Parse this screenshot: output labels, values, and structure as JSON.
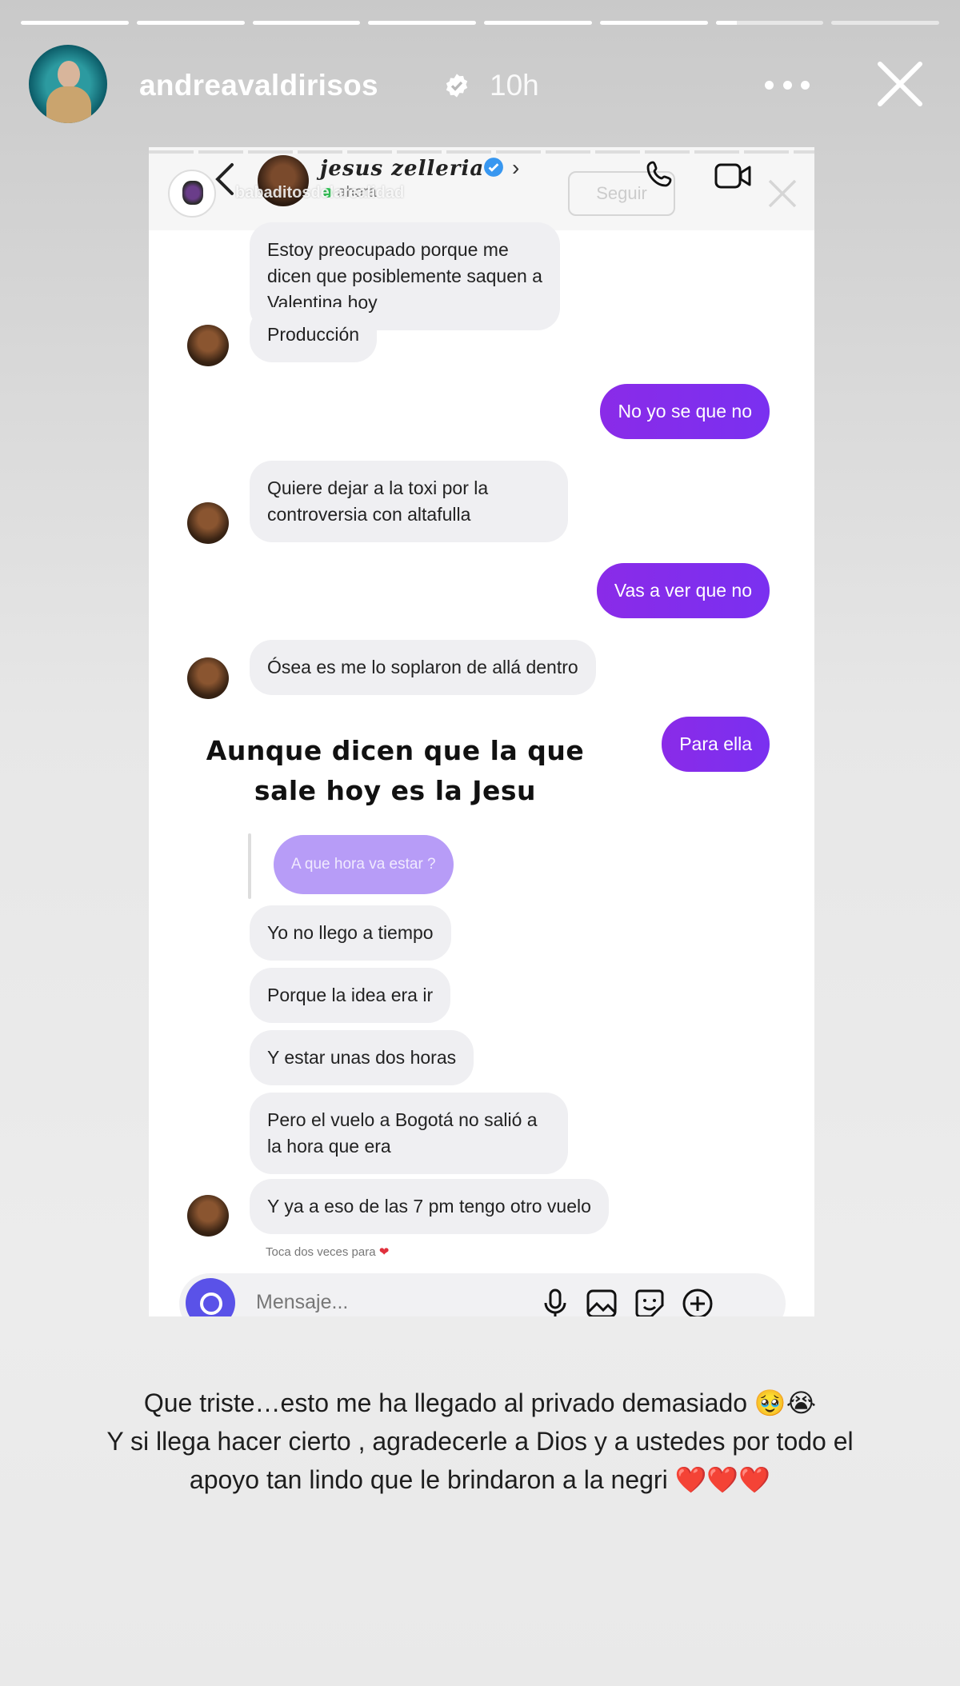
{
  "story": {
    "segments": [
      1,
      1,
      1,
      1,
      1,
      1,
      0.2,
      0
    ],
    "username": "andreavaldirisos",
    "time": "10h",
    "more_icon": "more-horizontal-icon",
    "close_icon": "close-icon"
  },
  "shared_chat": {
    "contact_name": "jesus zelleria",
    "status": "ahora",
    "overlay_handle": "babaditosdelarealidad",
    "overlay_follow": "Seguir",
    "messages": [
      {
        "dir": "in",
        "text": "Estoy preocupado porque me dicen que posiblemente saquen a Valentina hoy"
      },
      {
        "dir": "in",
        "text": "Producción"
      },
      {
        "dir": "out",
        "text": "No yo se que no"
      },
      {
        "dir": "in",
        "text": "Quiere dejar a la toxi por la controversia con altafulla"
      },
      {
        "dir": "out",
        "text": "Vas a ver que no"
      },
      {
        "dir": "in",
        "text": "Ósea es me lo soplaron de allá dentro"
      },
      {
        "dir": "out",
        "text": "Para ella"
      },
      {
        "dir": "in",
        "text": "Yo no llego a tiempo"
      },
      {
        "dir": "in",
        "text": "Porque la idea era ir"
      },
      {
        "dir": "in",
        "text": "Y estar unas dos horas"
      },
      {
        "dir": "in",
        "text": "Pero el vuelo a Bogotá no salió a la hora que era"
      },
      {
        "dir": "in",
        "text": "Y ya a eso de las 7 pm tengo otro vuelo"
      }
    ],
    "reply_quote": "A que hora va estar ?",
    "overlay_text": "Aunque dicen que la que sale hoy es la Jesu",
    "double_tap_hint": "Toca dos veces para",
    "composer_placeholder": "Mensaje...",
    "accent_color": "#7a30f0"
  },
  "caption": {
    "line1": "Que triste…esto me ha llegado al privado demasiado 🥹😭",
    "line2": "Y si llega hacer cierto , agradecerle a Dios y a ustedes por todo el",
    "line3": "apoyo tan lindo que le brindaron a la negri",
    "hearts": "❤️❤️❤️"
  }
}
